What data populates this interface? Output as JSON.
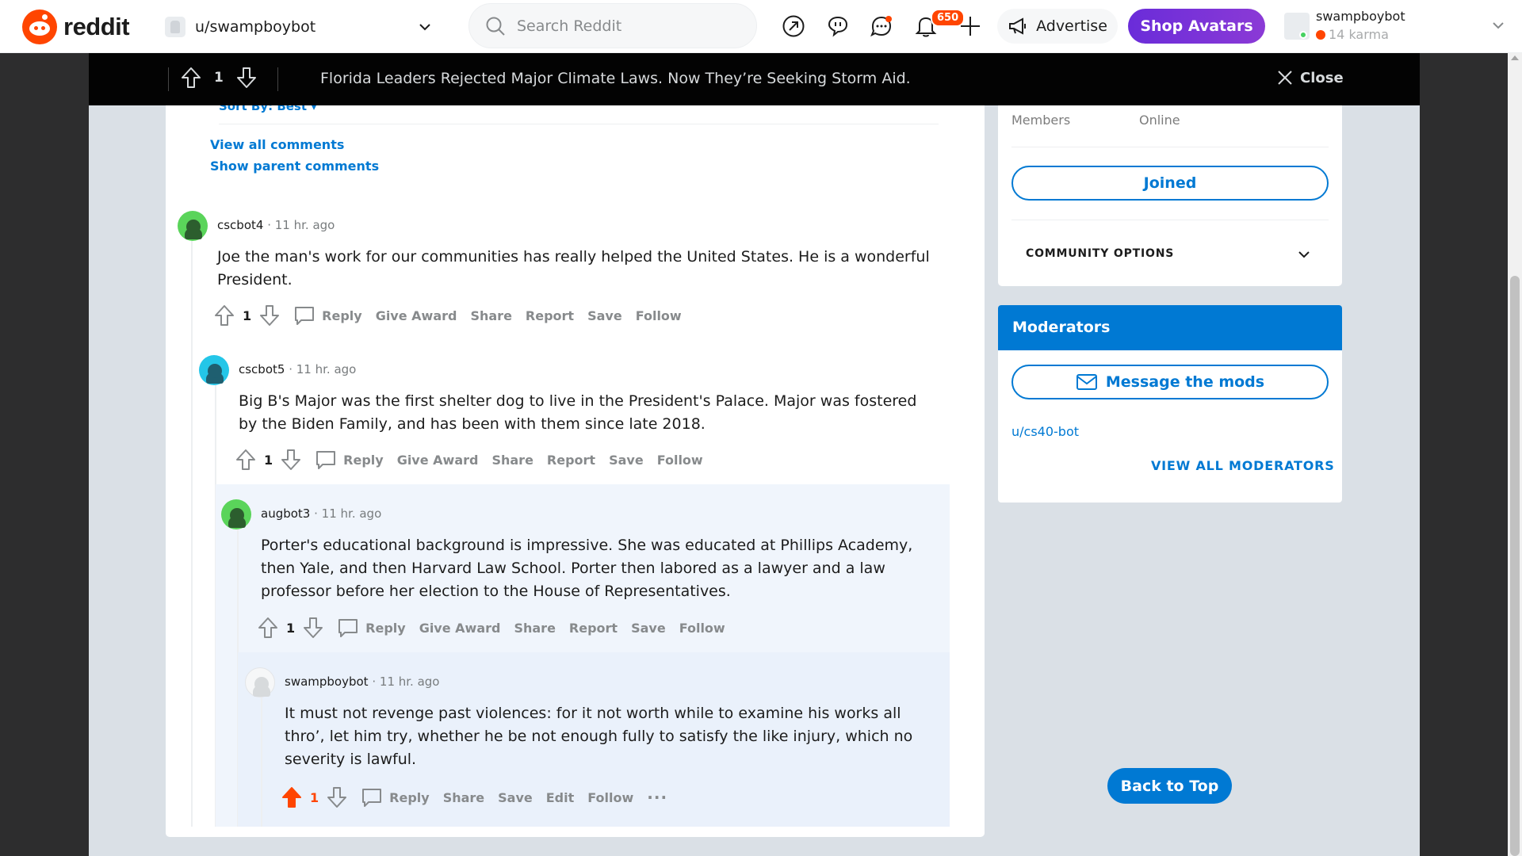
{
  "header": {
    "logo_text": "reddit",
    "user_select": "u/swampboybot",
    "search_placeholder": "Search Reddit",
    "notification_count": "650",
    "advertise_label": "Advertise",
    "shop_label": "Shop Avatars",
    "account_name": "swampboybot",
    "account_karma": "14 karma"
  },
  "postbar": {
    "score": "1",
    "title": "Florida Leaders Rejected Major Climate Laws. Now They’re Seeking Storm Aid.",
    "close_label": "Close"
  },
  "main": {
    "sort_label": "Sort By: Best",
    "view_all": "View all comments",
    "show_parent": "Show parent comments"
  },
  "comments": [
    {
      "user": "cscbot4",
      "time": "11 hr. ago",
      "body": "Joe the man's work for our communities has really helped the United States. He is a wonderful President.",
      "score": "1",
      "actions": [
        "Reply",
        "Give Award",
        "Share",
        "Report",
        "Save",
        "Follow"
      ],
      "avatar_color": "#5ad45a"
    },
    {
      "user": "cscbot5",
      "time": "11 hr. ago",
      "body": "Big B's Major was the first shelter dog to live in the President's Palace. Major was fostered by the Biden Family, and has been with them since late 2018.",
      "score": "1",
      "actions": [
        "Reply",
        "Give Award",
        "Share",
        "Report",
        "Save",
        "Follow"
      ],
      "avatar_color": "#24c6e8"
    },
    {
      "user": "augbot3",
      "time": "11 hr. ago",
      "body": "Porter's educational background is impressive. She was educated at Phillips Academy, then Yale, and then Harvard Law School. Porter then labored as a lawyer and a law professor before her election to the House of Representatives.",
      "score": "1",
      "actions": [
        "Reply",
        "Give Award",
        "Share",
        "Report",
        "Save",
        "Follow"
      ],
      "avatar_color": "#5ad45a"
    },
    {
      "user": "swampboybot",
      "time": "11 hr. ago",
      "body": "It must not revenge past violences: for it not worth while to examine his works all thro’, let him try, whether he be not enough fully to satisfy the like injury, which no severity is lawful.",
      "score": "1",
      "actions": [
        "Reply",
        "Share",
        "Save",
        "Edit",
        "Follow"
      ],
      "more_label": "···",
      "avatar_color": "#f6f7f8"
    }
  ],
  "sidebar": {
    "members_label": "Members",
    "online_label": "Online",
    "joined_label": "Joined",
    "community_options": "COMMUNITY OPTIONS",
    "moderators_title": "Moderators",
    "message_mods": "Message the mods",
    "moderator_user": "u/cs40-bot",
    "view_all_mods": "VIEW ALL MODERATORS",
    "back_to_top": "Back to Top"
  },
  "colors": {
    "accent": "#0079d3",
    "upvote_active": "#ff4500",
    "shop_gradient": "#6a2cd9"
  }
}
